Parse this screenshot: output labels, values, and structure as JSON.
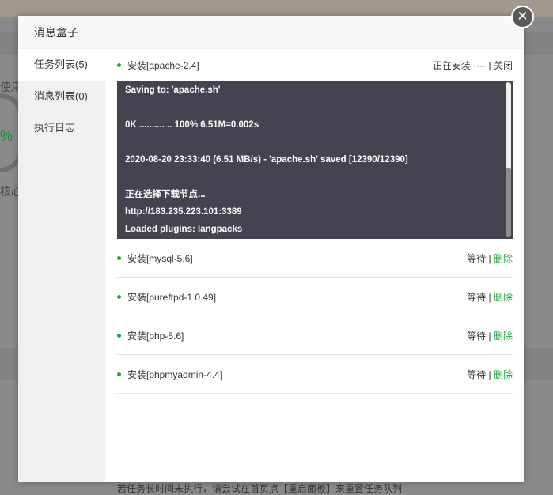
{
  "background": {
    "text_use": "使用",
    "text_percent": "%",
    "text_core": "核心"
  },
  "modal": {
    "title": "消息盒子",
    "close_icon": "close-icon",
    "sidebar": [
      {
        "label": "任务列表(5)",
        "active": true
      },
      {
        "label": "消息列表(0)",
        "active": false
      },
      {
        "label": "执行日志",
        "active": false
      }
    ],
    "current_task": {
      "name": "安装[apache-2.4]",
      "status": "正在安装 ····",
      "separator": " | ",
      "close": "关闭"
    },
    "console_lines": [
      "Saving to: 'apache.sh'",
      "",
      "0K .......... .. 100% 6.51M=0.002s",
      "",
      "2020-08-20 23:33:40 (6.51 MB/s) - 'apache.sh' saved [12390/12390]",
      "",
      "正在选择下载节点...",
      "http://183.235.223.101:3389",
      "Loaded plugins: langpacks"
    ],
    "tasks": [
      {
        "name": "安装[mysql-5.6]",
        "status": "等待",
        "separator": " | ",
        "action": "删除"
      },
      {
        "name": "安装[pureftpd-1.0.49]",
        "status": "等待",
        "separator": " | ",
        "action": "删除"
      },
      {
        "name": "安装[php-5.6]",
        "status": "等待",
        "separator": " | ",
        "action": "删除"
      },
      {
        "name": "安装[phpmyadmin-4.4]",
        "status": "等待",
        "separator": " | ",
        "action": "删除"
      }
    ],
    "hint": "若任务长时间未执行，请尝试在首页点【重启面板】来重置任务队列",
    "colors": {
      "accent": "#20a53a",
      "console_bg": "#44434f"
    }
  }
}
